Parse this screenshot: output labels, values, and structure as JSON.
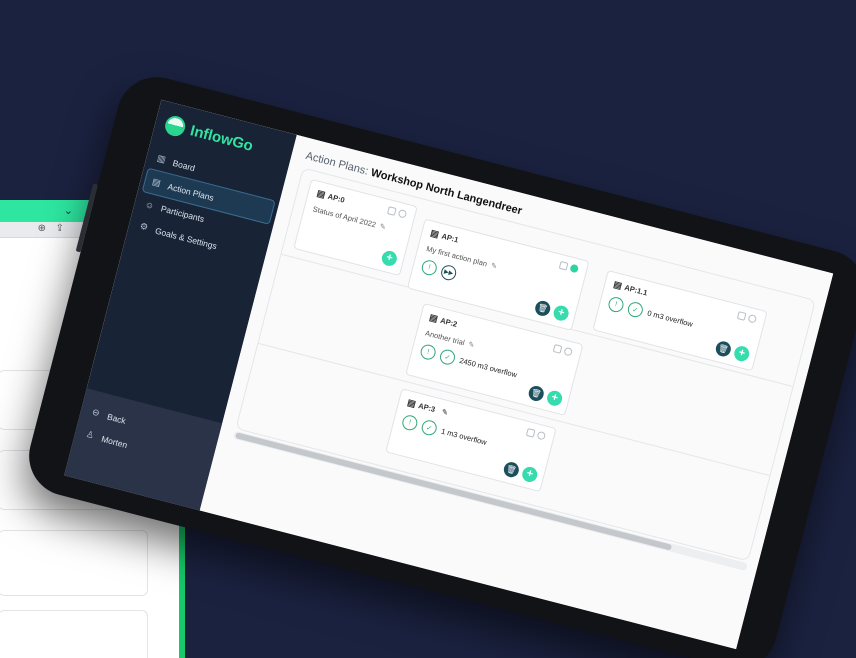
{
  "app": {
    "name": "InflowGo"
  },
  "sidebar": {
    "items": [
      {
        "label": "Board",
        "icon": "map-icon"
      },
      {
        "label": "Action Plans",
        "icon": "clipboard-icon",
        "active": true
      },
      {
        "label": "Participants",
        "icon": "users-icon"
      },
      {
        "label": "Goals & Settings",
        "icon": "gear-icon"
      }
    ],
    "back_label": "Back",
    "user_name": "Morten"
  },
  "page": {
    "title_prefix": "Action Plans:",
    "workshop_name": "Workshop North Langendreer"
  },
  "cards": [
    {
      "id": "AP:0",
      "description": "Status of April 2022"
    },
    {
      "id": "AP:1",
      "description": "My first action plan"
    },
    {
      "id": "AP:1.1",
      "overflow": "0 m3 overflow"
    },
    {
      "id": "AP:2",
      "description": "Another trial",
      "overflow": "2450 m3 overflow"
    },
    {
      "id": "AP:3",
      "overflow": "1 m3 overflow"
    }
  ],
  "colors": {
    "accent": "#36dcae",
    "brand": "#33e3a0",
    "sidebar": "#182436",
    "dark_button": "#1d4e5c",
    "background": "#1b2240"
  }
}
